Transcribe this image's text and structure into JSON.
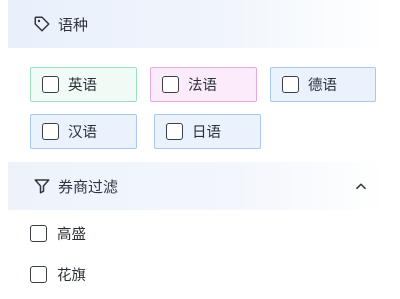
{
  "language_section": {
    "title": "语种",
    "icon": "tag-icon",
    "options": [
      {
        "label": "英语",
        "checked": false,
        "color": "#9fe0bf"
      },
      {
        "label": "法语",
        "checked": false,
        "color": "#e6a9e1"
      },
      {
        "label": "德语",
        "checked": false,
        "color": "#a8c8ef"
      },
      {
        "label": "汉语",
        "checked": false,
        "color": "#a8c8ef"
      },
      {
        "label": "日语",
        "checked": false,
        "color": "#a8c8ef"
      }
    ]
  },
  "broker_section": {
    "title": "券商过滤",
    "icon": "filter-icon",
    "expanded": true,
    "options": [
      {
        "label": "高盛",
        "checked": false
      },
      {
        "label": "花旗",
        "checked": false
      }
    ]
  }
}
